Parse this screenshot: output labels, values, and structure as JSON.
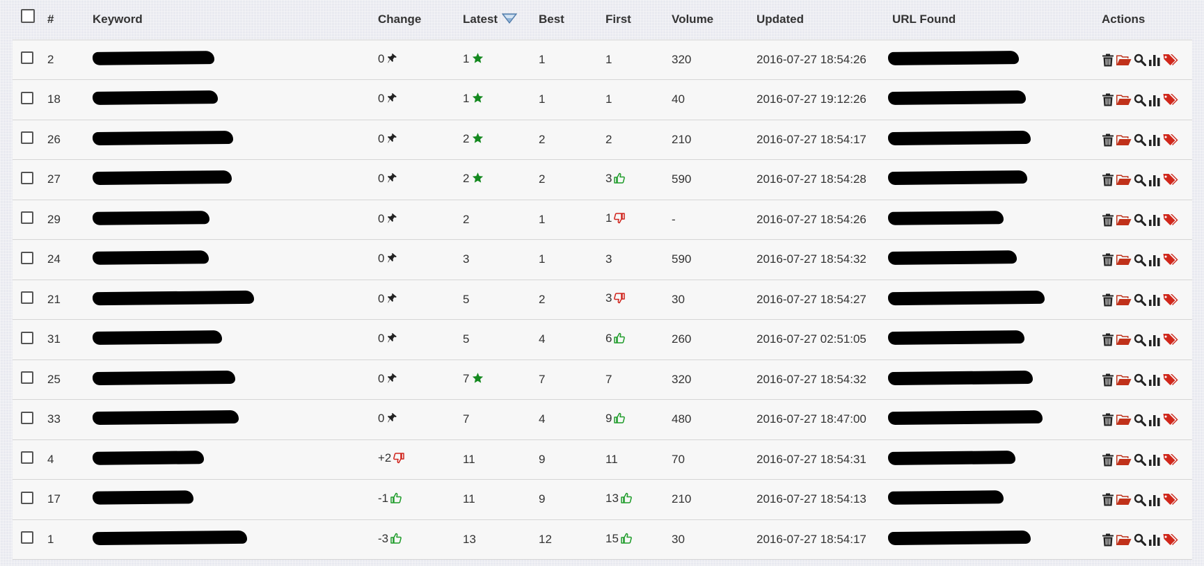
{
  "header": {
    "num": "#",
    "keyword": "Keyword",
    "change": "Change",
    "latest": "Latest",
    "best": "Best",
    "first": "First",
    "volume": "Volume",
    "updated": "Updated",
    "url": "URL Found",
    "actions": "Actions"
  },
  "sort": {
    "column": "latest",
    "icon": "sort-down-arrow-icon"
  },
  "colors": {
    "star": "#14891f",
    "thumbs_up": "#1f9c2a",
    "thumbs_down": "#d0221b",
    "folder": "#c0311a",
    "tag": "#d0271b"
  },
  "rows": [
    {
      "num": "2",
      "change": "0",
      "change_icon": "pin-icon",
      "latest": "1",
      "latest_icon": "star-icon",
      "best": "1",
      "first": "1",
      "first_icon": "",
      "volume": "320",
      "updated": "2016-07-27 18:54:26"
    },
    {
      "num": "18",
      "change": "0",
      "change_icon": "pin-icon",
      "latest": "1",
      "latest_icon": "star-icon",
      "best": "1",
      "first": "1",
      "first_icon": "",
      "volume": "40",
      "updated": "2016-07-27 19:12:26"
    },
    {
      "num": "26",
      "change": "0",
      "change_icon": "pin-icon",
      "latest": "2",
      "latest_icon": "star-icon",
      "best": "2",
      "first": "2",
      "first_icon": "",
      "volume": "210",
      "updated": "2016-07-27 18:54:17"
    },
    {
      "num": "27",
      "change": "0",
      "change_icon": "pin-icon",
      "latest": "2",
      "latest_icon": "star-icon",
      "best": "2",
      "first": "3",
      "first_icon": "thumbs-up-icon",
      "volume": "590",
      "updated": "2016-07-27 18:54:28"
    },
    {
      "num": "29",
      "change": "0",
      "change_icon": "pin-icon",
      "latest": "2",
      "latest_icon": "",
      "best": "1",
      "first": "1",
      "first_icon": "thumbs-down-icon",
      "volume": "-",
      "updated": "2016-07-27 18:54:26"
    },
    {
      "num": "24",
      "change": "0",
      "change_icon": "pin-icon",
      "latest": "3",
      "latest_icon": "",
      "best": "1",
      "first": "3",
      "first_icon": "",
      "volume": "590",
      "updated": "2016-07-27 18:54:32"
    },
    {
      "num": "21",
      "change": "0",
      "change_icon": "pin-icon",
      "latest": "5",
      "latest_icon": "",
      "best": "2",
      "first": "3",
      "first_icon": "thumbs-down-icon",
      "volume": "30",
      "updated": "2016-07-27 18:54:27"
    },
    {
      "num": "31",
      "change": "0",
      "change_icon": "pin-icon",
      "latest": "5",
      "latest_icon": "",
      "best": "4",
      "first": "6",
      "first_icon": "thumbs-up-icon",
      "volume": "260",
      "updated": "2016-07-27 02:51:05"
    },
    {
      "num": "25",
      "change": "0",
      "change_icon": "pin-icon",
      "latest": "7",
      "latest_icon": "star-icon",
      "best": "7",
      "first": "7",
      "first_icon": "",
      "volume": "320",
      "updated": "2016-07-27 18:54:32"
    },
    {
      "num": "33",
      "change": "0",
      "change_icon": "pin-icon",
      "latest": "7",
      "latest_icon": "",
      "best": "4",
      "first": "9",
      "first_icon": "thumbs-up-icon",
      "volume": "480",
      "updated": "2016-07-27 18:47:00"
    },
    {
      "num": "4",
      "change": "+2",
      "change_icon": "thumbs-down-icon",
      "latest": "11",
      "latest_icon": "",
      "best": "9",
      "first": "11",
      "first_icon": "",
      "volume": "70",
      "updated": "2016-07-27 18:54:31"
    },
    {
      "num": "17",
      "change": "-1",
      "change_icon": "thumbs-up-icon",
      "latest": "11",
      "latest_icon": "",
      "best": "9",
      "first": "13",
      "first_icon": "thumbs-up-icon",
      "volume": "210",
      "updated": "2016-07-27 18:54:13"
    },
    {
      "num": "1",
      "change": "-3",
      "change_icon": "thumbs-up-icon",
      "latest": "13",
      "latest_icon": "",
      "best": "12",
      "first": "15",
      "first_icon": "thumbs-up-icon",
      "volume": "30",
      "updated": "2016-07-27 18:54:17"
    }
  ],
  "row_actions": [
    "trash-icon",
    "folder-open-icon",
    "search-icon",
    "bar-chart-icon",
    "tags-icon"
  ]
}
